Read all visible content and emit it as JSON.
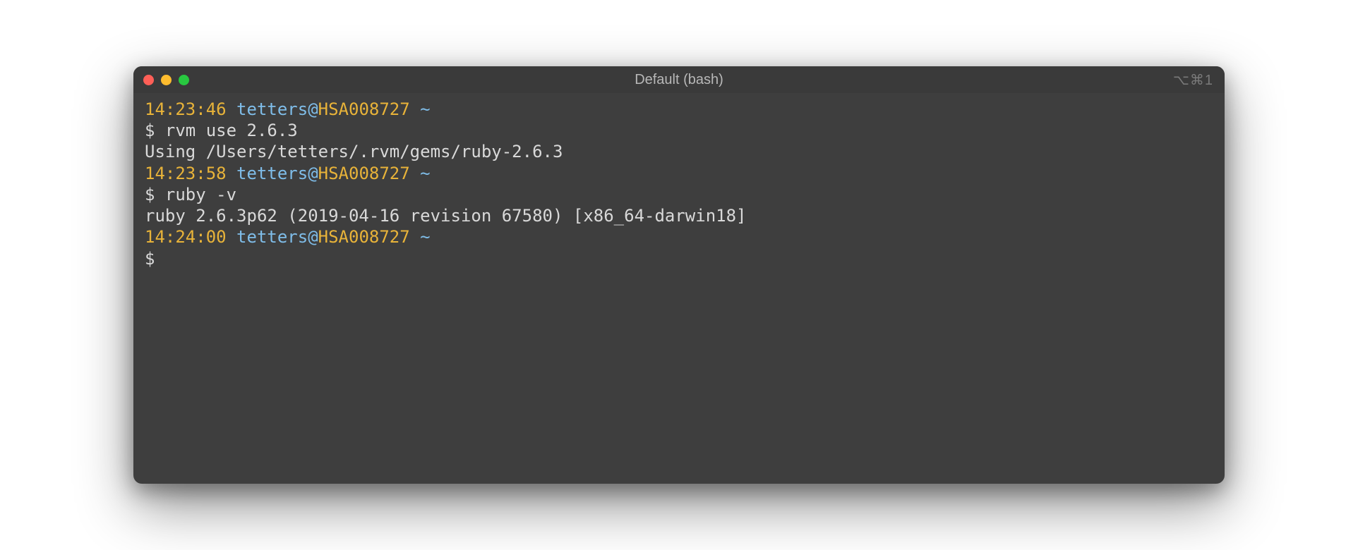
{
  "window": {
    "title": "Default (bash)",
    "tabhint": "⌥⌘1"
  },
  "prompts": [
    {
      "time": "14:23:46",
      "user": "tetters",
      "at": "@",
      "host": "HSA008727",
      "path": " ~"
    },
    {
      "time": "14:23:58",
      "user": "tetters",
      "at": "@",
      "host": "HSA008727",
      "path": " ~"
    },
    {
      "time": "14:24:00",
      "user": "tetters",
      "at": "@",
      "host": "HSA008727",
      "path": " ~"
    }
  ],
  "commands": {
    "sym": "$ ",
    "c0": "rvm use 2.6.3",
    "c1": "ruby -v",
    "c2": ""
  },
  "output": {
    "o0": "Using /Users/tetters/.rvm/gems/ruby-2.6.3",
    "o1": "ruby 2.6.3p62 (2019-04-16 revision 67580) [x86_64-darwin18]"
  }
}
